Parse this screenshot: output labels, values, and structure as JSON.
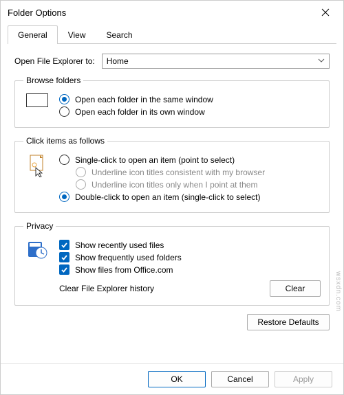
{
  "title": "Folder Options",
  "tabs": [
    "General",
    "View",
    "Search"
  ],
  "activeTab": 0,
  "openTo": {
    "label": "Open File Explorer to:",
    "value": "Home"
  },
  "groups": {
    "browse": {
      "legend": "Browse folders",
      "opts": [
        {
          "label": "Open each folder in the same window",
          "sel": true
        },
        {
          "label": "Open each folder in its own window",
          "sel": false
        }
      ]
    },
    "click": {
      "legend": "Click items as follows",
      "single": "Single-click to open an item (point to select)",
      "u1": "Underline icon titles consistent with my browser",
      "u2": "Underline icon titles only when I point at them",
      "double": "Double-click to open an item (single-click to select)"
    },
    "privacy": {
      "legend": "Privacy",
      "c1": "Show recently used files",
      "c2": "Show frequently used folders",
      "c3": "Show files from Office.com",
      "clearLabel": "Clear File Explorer history",
      "clearBtn": "Clear"
    }
  },
  "restore": "Restore Defaults",
  "footer": {
    "ok": "OK",
    "cancel": "Cancel",
    "apply": "Apply"
  },
  "watermark": "wsxdn.com"
}
